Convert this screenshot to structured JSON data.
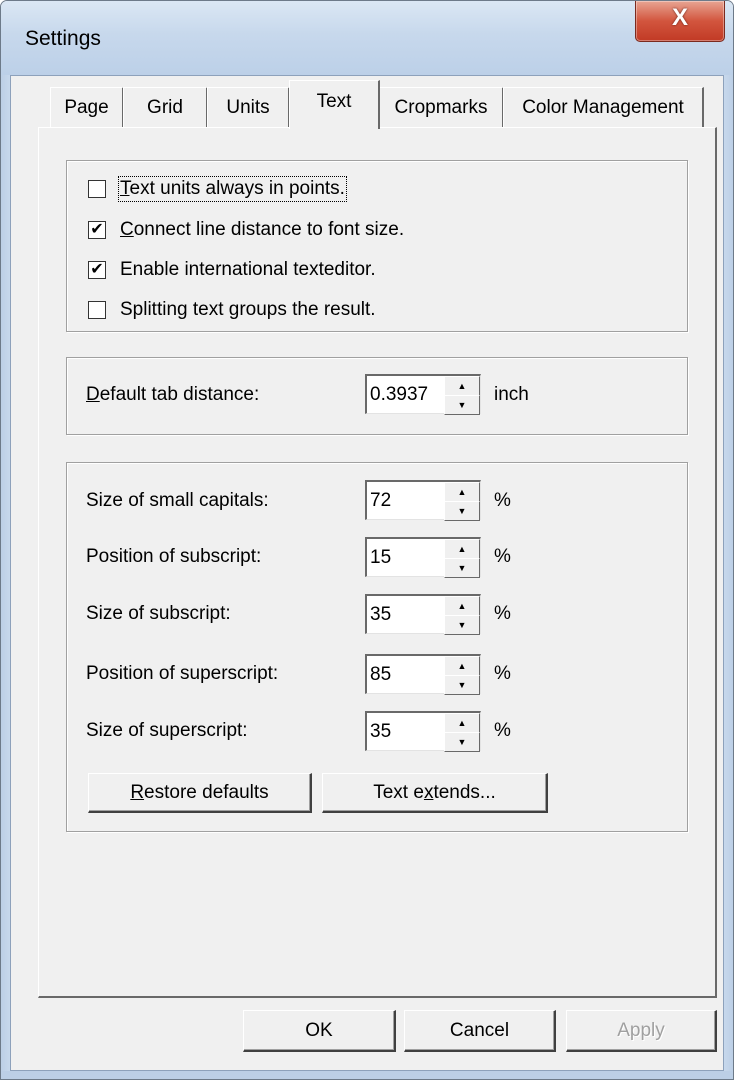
{
  "window": {
    "title": "Settings",
    "close_label": "X"
  },
  "tabs": [
    {
      "label": "Page",
      "active": false
    },
    {
      "label": "Grid",
      "active": false
    },
    {
      "label": "Units",
      "active": false
    },
    {
      "label": "Text",
      "active": true
    },
    {
      "label": "Cropmarks",
      "active": false
    },
    {
      "label": "Color Management",
      "active": false
    }
  ],
  "options": [
    {
      "label": "Text units always in points.",
      "checked": false,
      "mnemonic": "T",
      "focused": true
    },
    {
      "label": "Connect line distance to font size.",
      "checked": true,
      "mnemonic": "C",
      "focused": false
    },
    {
      "label": "Enable international texteditor.",
      "checked": true,
      "mnemonic": "",
      "focused": false
    },
    {
      "label": "Splitting text groups the result.",
      "checked": false,
      "mnemonic": "",
      "focused": false
    }
  ],
  "tab_distance": {
    "label": "Default tab distance:",
    "value": "0.3937",
    "unit": "inch"
  },
  "sizes": [
    {
      "label": "Size of small capitals:",
      "value": "72",
      "unit": "%"
    },
    {
      "label": "Position of subscript:",
      "value": "15",
      "unit": "%"
    },
    {
      "label": "Size of subscript:",
      "value": "35",
      "unit": "%"
    },
    {
      "label": "Position of superscript:",
      "value": "85",
      "unit": "%"
    },
    {
      "label": "Size of superscript:",
      "value": "35",
      "unit": "%"
    }
  ],
  "buttons": {
    "restore_defaults": "Restore defaults",
    "text_extends": "Text extends...",
    "ok": "OK",
    "cancel": "Cancel",
    "apply": "Apply"
  }
}
